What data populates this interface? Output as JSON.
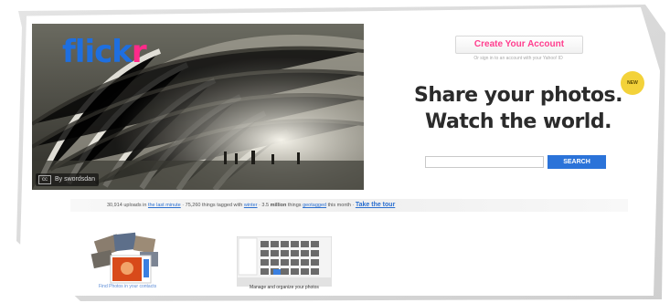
{
  "brand": {
    "logo_part_1": "flick",
    "logo_part_2": "r",
    "logo_colors": {
      "blue": "#1e6fe0",
      "pink": "#ff2a8a"
    }
  },
  "hero": {
    "photo_credit": "By swordsdan",
    "cc_label": "cc"
  },
  "account": {
    "create_label": "Create Your Account",
    "create_sublabel": "Or sign in to an account with your Yahoo! ID"
  },
  "tagline": {
    "line1": "Share your photos.",
    "line2": "Watch the world.",
    "badge": "NEW"
  },
  "search": {
    "placeholder": "",
    "button_label": "SEARCH"
  },
  "stats": {
    "part1": "30,914 uploads in ",
    "link1": "the last minute",
    "part2": " · 75,260 things tagged with ",
    "link2": "winter",
    "part3": " · 3.5 ",
    "strong": "million",
    "part4": " things ",
    "link3": "geotagged",
    "part5": " this month · ",
    "tour": "Take the tour"
  },
  "features": {
    "thumb_caption": "Find Photos in your contacts",
    "organizr_caption": "Manage and organize your photos"
  },
  "colors": {
    "accent_blue": "#2b73d9",
    "accent_pink": "#ff3e8e",
    "text_dark": "#2b2b2b"
  }
}
